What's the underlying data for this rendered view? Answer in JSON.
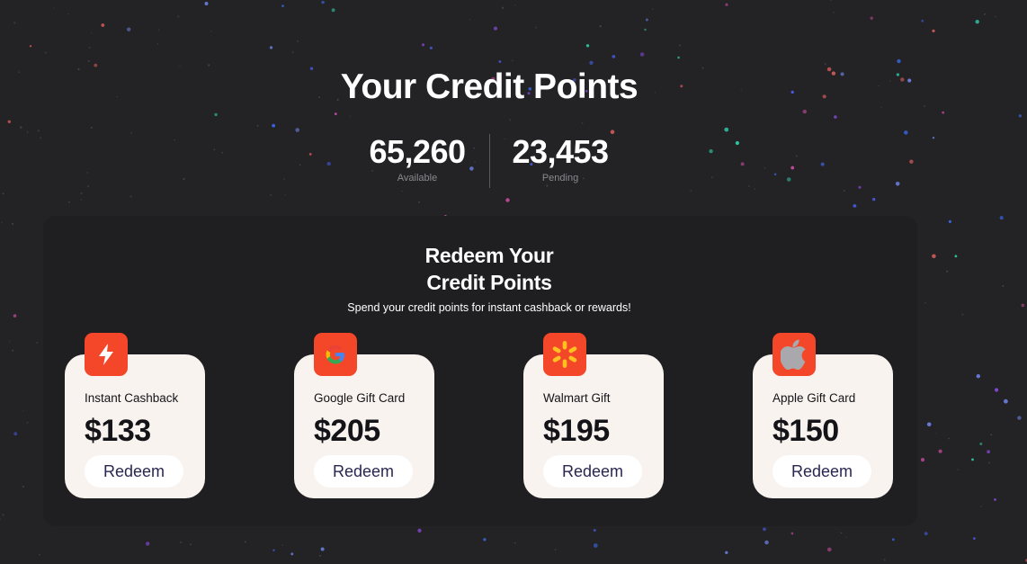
{
  "header": {
    "title": "Your Credit Points",
    "stats": {
      "available": {
        "value": "65,260",
        "label": "Available"
      },
      "pending": {
        "value": "23,453",
        "label": "Pending"
      }
    }
  },
  "redeem": {
    "title_line1": "Redeem Your",
    "title_line2": "Credit Points",
    "subtitle": "Spend your credit points for instant cashback or rewards!"
  },
  "cards": [
    {
      "name": "Instant Cashback",
      "amount": "$133",
      "button": "Redeem",
      "icon": "lightning-icon"
    },
    {
      "name": "Google Gift Card",
      "amount": "$205",
      "button": "Redeem",
      "icon": "google-icon"
    },
    {
      "name": "Walmart Gift",
      "amount": "$195",
      "button": "Redeem",
      "icon": "walmart-spark-icon"
    },
    {
      "name": "Apple Gift Card",
      "amount": "$150",
      "button": "Redeem",
      "icon": "apple-icon"
    }
  ],
  "colors": {
    "background": "#232224",
    "accent": "#f4472a",
    "card": "#f8f3ef",
    "button_text": "#2a2650"
  }
}
